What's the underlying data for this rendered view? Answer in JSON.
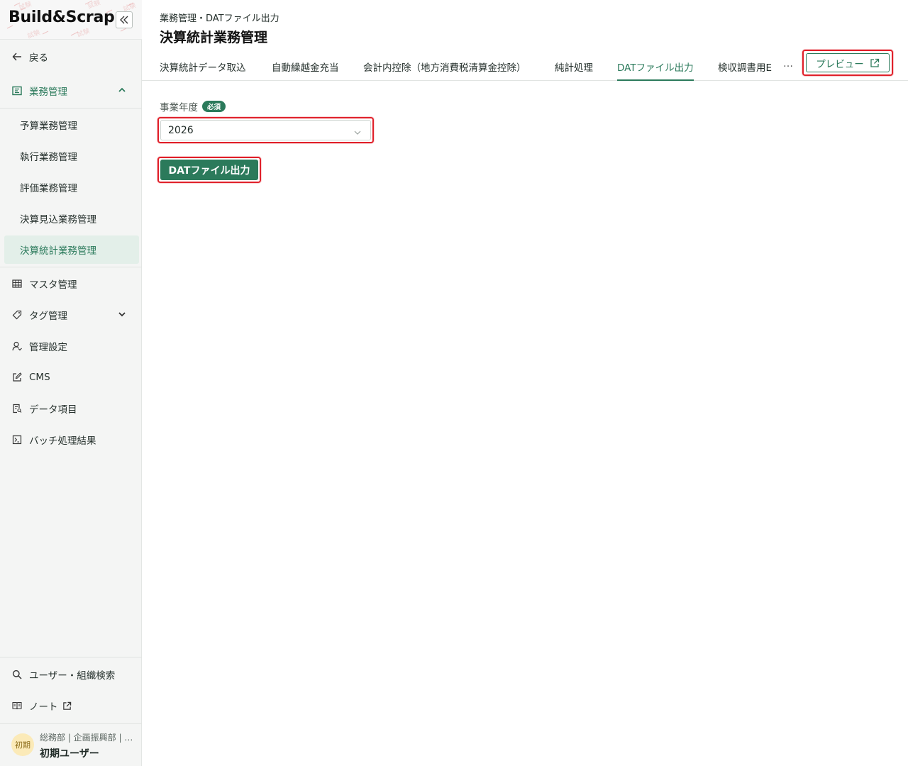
{
  "app": {
    "logo_text": "Build&Scrap"
  },
  "sidebar": {
    "back_label": "戻る",
    "business": {
      "label": "業務管理",
      "children": [
        "予算業務管理",
        "執行業務管理",
        "評価業務管理",
        "決算見込業務管理",
        "決算統計業務管理"
      ],
      "selected_child": "決算統計業務管理"
    },
    "master_label": "マスタ管理",
    "tag_label": "タグ管理",
    "admin_label": "管理設定",
    "cms_label": "CMS",
    "data_items_label": "データ項目",
    "batch_label": "バッチ処理結果",
    "user_search_label": "ユーザー・組織検索",
    "note_label": "ノート"
  },
  "user": {
    "avatar_text": "初期",
    "org": "総務部 | 企画振興部 | …",
    "name": "初期ユーザー"
  },
  "header": {
    "breadcrumb": "業務管理・DATファイル出力",
    "title": "決算統計業務管理"
  },
  "tabs": [
    {
      "label": "決算統計データ取込"
    },
    {
      "label": "自動繰越金充当"
    },
    {
      "label": "会計内控除（地方消費税清算金控除）"
    },
    {
      "label": "純計処理"
    },
    {
      "label": "DATファイル出力",
      "active": true
    },
    {
      "label": "検収調書用E"
    }
  ],
  "tabs_more": "…",
  "preview_label": "プレビュー",
  "form": {
    "year_label": "事業年度",
    "required_badge": "必須",
    "year_value": "2026",
    "submit_label": "DATファイル出力"
  },
  "colors": {
    "accent": "#2b7a5b",
    "highlight": "#e0202a"
  }
}
